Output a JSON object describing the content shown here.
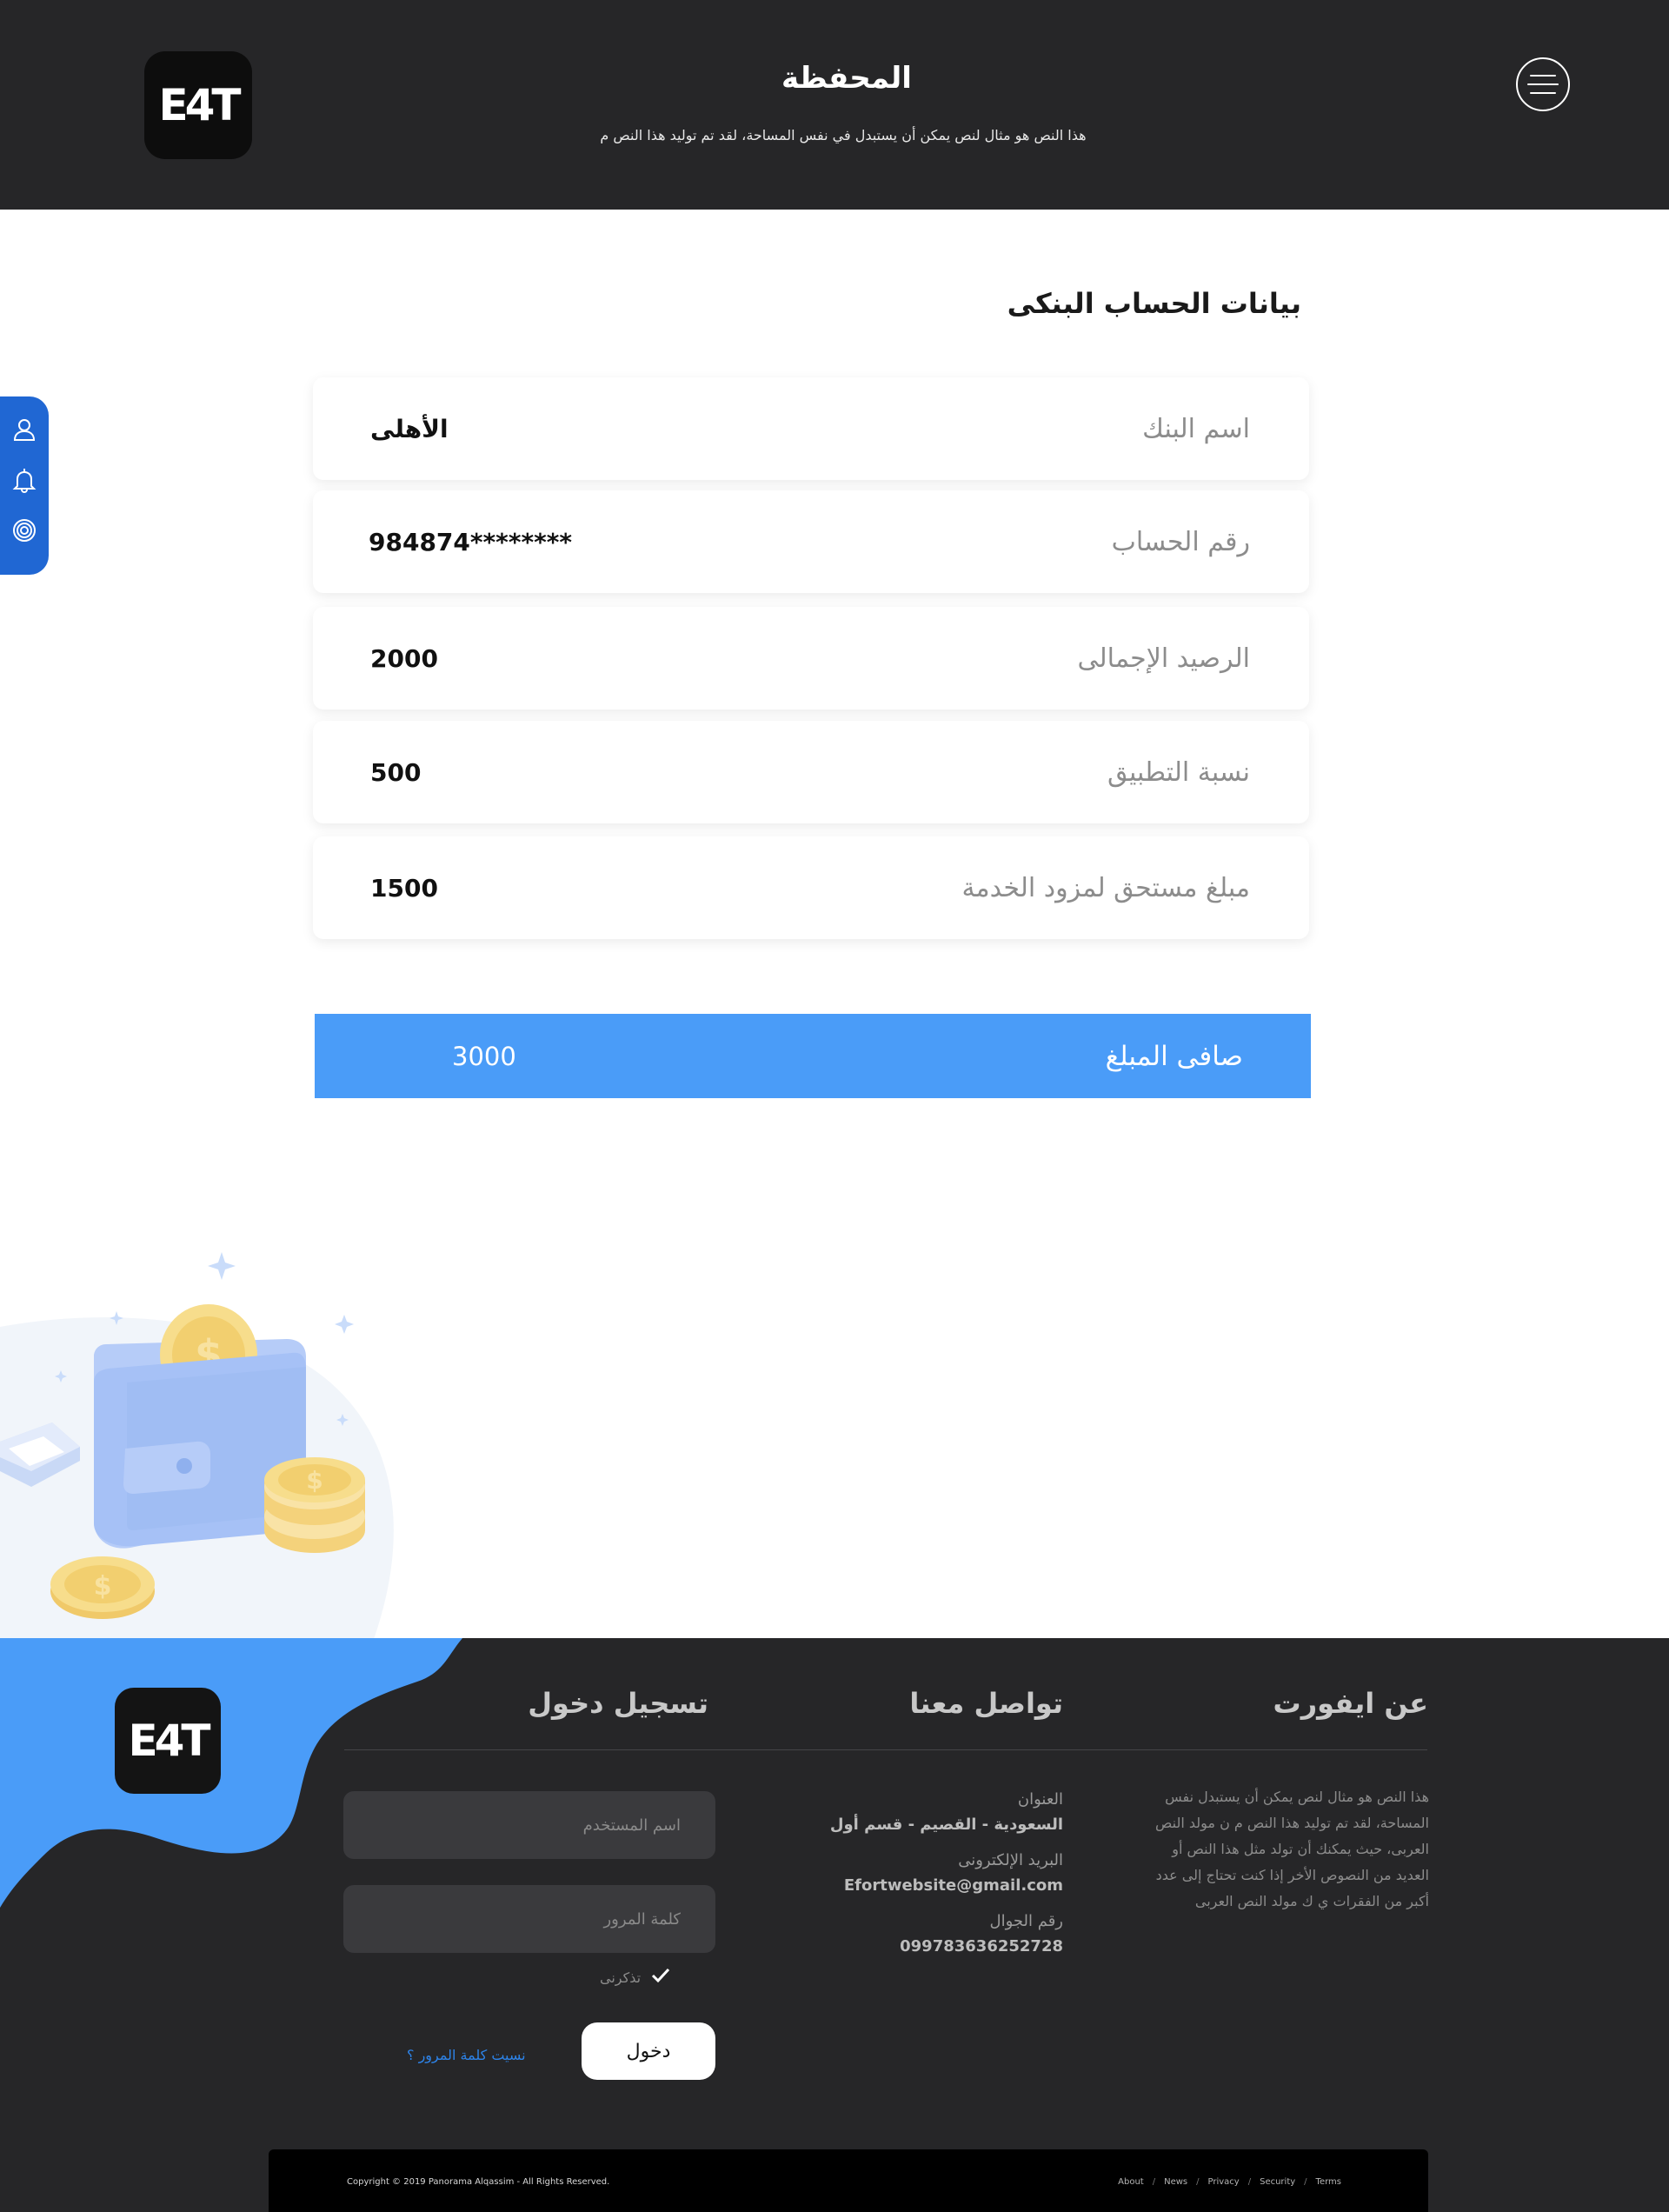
{
  "header": {
    "logo_text": "E4T",
    "title": "المحفظة",
    "subtitle": "هذا النص هو مثال لنص يمكن أن يستبدل في نفس المساحة، لقد تم توليد هذا النص م"
  },
  "side_toolbar": {
    "icons": [
      "user-icon",
      "bell-icon",
      "target-icon"
    ]
  },
  "main": {
    "section_title": "بيانات الحساب البنكى",
    "fields": [
      {
        "label": "اسم البنك",
        "value": "الأهلى"
      },
      {
        "label": "رقم الحساب",
        "value": "984874********"
      },
      {
        "label": "الرصيد الإجمالى",
        "value": "2000"
      },
      {
        "label": "نسبة التطبيق",
        "value": "500"
      },
      {
        "label": "مبلغ مستحق لمزود الخدمة",
        "value": "1500"
      }
    ],
    "net": {
      "label": "صافى المبلغ",
      "value": "3000"
    }
  },
  "footer": {
    "logo_text": "E4T",
    "about": {
      "title": "عن ايفورت",
      "text": "هذا النص هو مثال لنص يمكن أن يستبدل نفس المساحة، لقد تم توليد هذا النص م ن مولد النص العربى، حيث يمكنك أن تولد مثل هذا النص أو العديد من النصوص الأخر إذا كنت تحتاج إلى عدد أكبر من الفقرات ي ك مولد النص العربى"
    },
    "contact": {
      "title": "تواصل معنا",
      "address_label": "العنوان",
      "address_value": "السعودية - القصيم - قسم أول",
      "email_label": "البريد الإلكترونى",
      "email_value": "Efortwebsite@gmail.com",
      "phone_label": "رقم الجوال",
      "phone_value": "099783636252728"
    },
    "login": {
      "title": "تسجيل دخول",
      "username_placeholder": "اسم المستخدم",
      "password_placeholder": "كلمة المرور",
      "remember_label": "تذكرنى",
      "submit_label": "دخول",
      "forgot_label": "نسيت كلمة المرور ؟"
    },
    "copyright": "Copyright © 2019  Panorama Alqassim -  All Rights Reserved.",
    "links": [
      "About",
      "News",
      "Privacy",
      "Security",
      "Terms"
    ],
    "link_separator": "/"
  },
  "colors": {
    "header_bg": "#262628",
    "accent_blue": "#4a9cf8",
    "sidebar_blue": "#2067d3",
    "footer_bg": "#262628"
  }
}
